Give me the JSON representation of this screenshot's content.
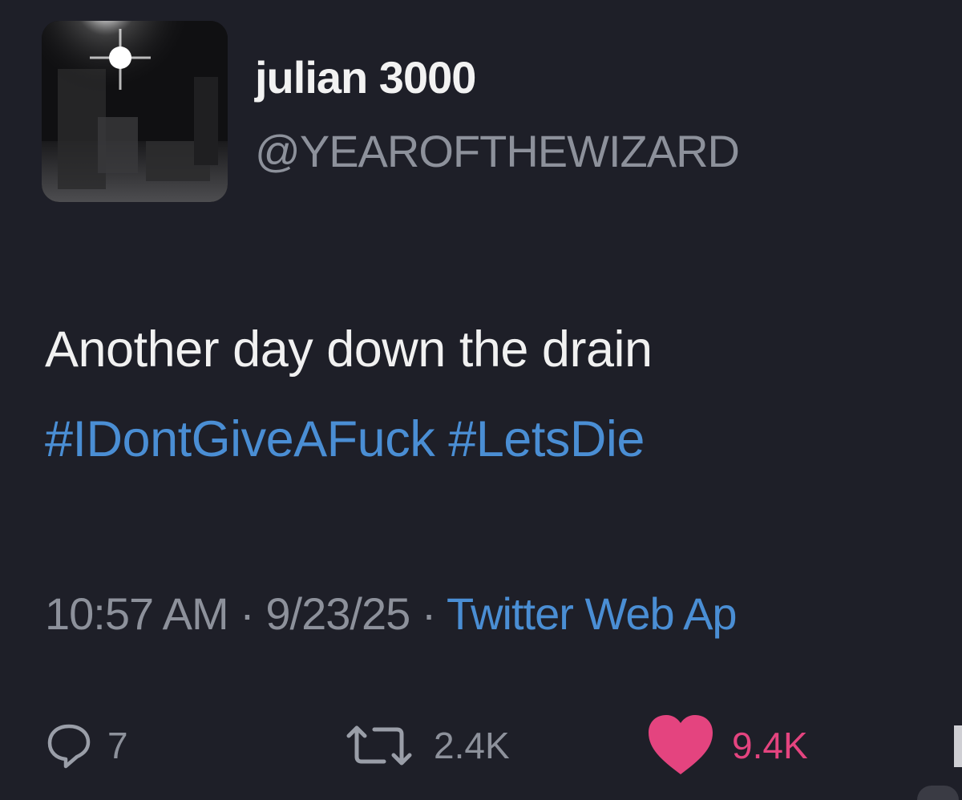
{
  "user": {
    "display_name": "julian 3000",
    "handle": "@YEAROFTHEWIZARD"
  },
  "tweet": {
    "text": "Another day down the drain",
    "hashtags": [
      "#IDontGiveAFuck",
      "#LetsDie"
    ]
  },
  "meta": {
    "time": "10:57 AM",
    "separator": "·",
    "date": "9/23/25",
    "source": "Twitter Web Ap"
  },
  "actions": {
    "replies": "7",
    "retweets": "2.4K",
    "likes": "9.4K"
  },
  "colors": {
    "background": "#1e1f28",
    "hashtag": "#4a8ed4",
    "muted": "#8d919b",
    "like": "#e4447f"
  },
  "icons": [
    "reply-icon",
    "retweet-icon",
    "heart-icon"
  ]
}
